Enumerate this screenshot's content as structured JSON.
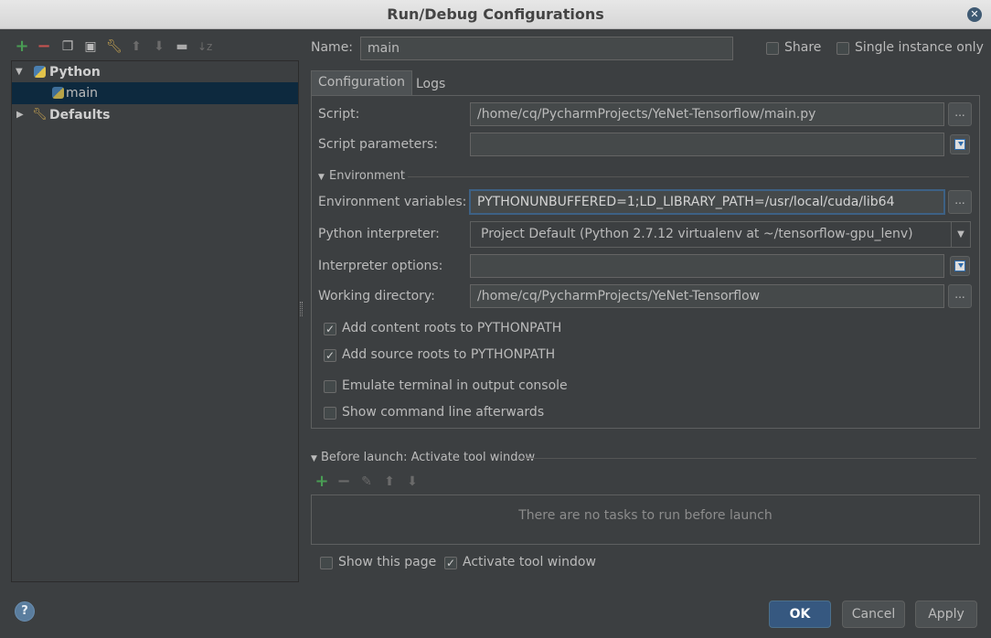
{
  "window": {
    "title": "Run/Debug Configurations"
  },
  "toolbar": {
    "icons": [
      "add-icon",
      "remove-icon",
      "copy-icon",
      "save-icon",
      "wrench-icon",
      "move-up-icon",
      "move-down-icon",
      "folder-icon",
      "sort-icon"
    ]
  },
  "tree": {
    "python_label": "Python",
    "main_label": "main",
    "defaults_label": "Defaults"
  },
  "name_field": {
    "label": "Name:",
    "value": "main"
  },
  "share_label": "Share",
  "single_instance_label": "Single instance only",
  "tabs": {
    "configuration": "Configuration",
    "logs": "Logs"
  },
  "config": {
    "script_label": "Script:",
    "script_value": "/home/cq/PycharmProjects/YeNet-Tensorflow/main.py",
    "script_params_label": "Script parameters:",
    "script_params_value": "",
    "environment_section": "Environment",
    "env_vars_label": "Environment variables:",
    "env_vars_value": "PYTHONUNBUFFERED=1;LD_LIBRARY_PATH=/usr/local/cuda/lib64",
    "interpreter_label": "Python interpreter:",
    "interpreter_value": "Project Default (Python 2.7.12 virtualenv at ~/tensorflow-gpu_lenv)",
    "interp_options_label": "Interpreter options:",
    "interp_options_value": "",
    "workdir_label": "Working directory:",
    "workdir_value": "/home/cq/PycharmProjects/YeNet-Tensorflow",
    "checkboxes": {
      "content_roots": {
        "label": "Add content roots to PYTHONPATH",
        "checked": true
      },
      "source_roots": {
        "label": "Add source roots to PYTHONPATH",
        "checked": true
      },
      "emulate_terminal": {
        "label": "Emulate terminal in output console",
        "checked": false
      },
      "show_cmdline": {
        "label": "Show command line afterwards",
        "checked": false
      }
    },
    "ellipsis": "..."
  },
  "before_launch": {
    "title": "Before launch: Activate tool window",
    "empty_text": "There are no tasks to run before launch",
    "show_page": {
      "label": "Show this page",
      "checked": false
    },
    "activate_tool": {
      "label": "Activate tool window",
      "checked": true
    }
  },
  "buttons": {
    "ok": "OK",
    "cancel": "Cancel",
    "apply": "Apply",
    "help": "?"
  },
  "colors": {
    "background": "#3c3f41",
    "selection": "#0d293e",
    "primary_button": "#365880",
    "add_green": "#499c54",
    "remove_red": "#c75450"
  }
}
